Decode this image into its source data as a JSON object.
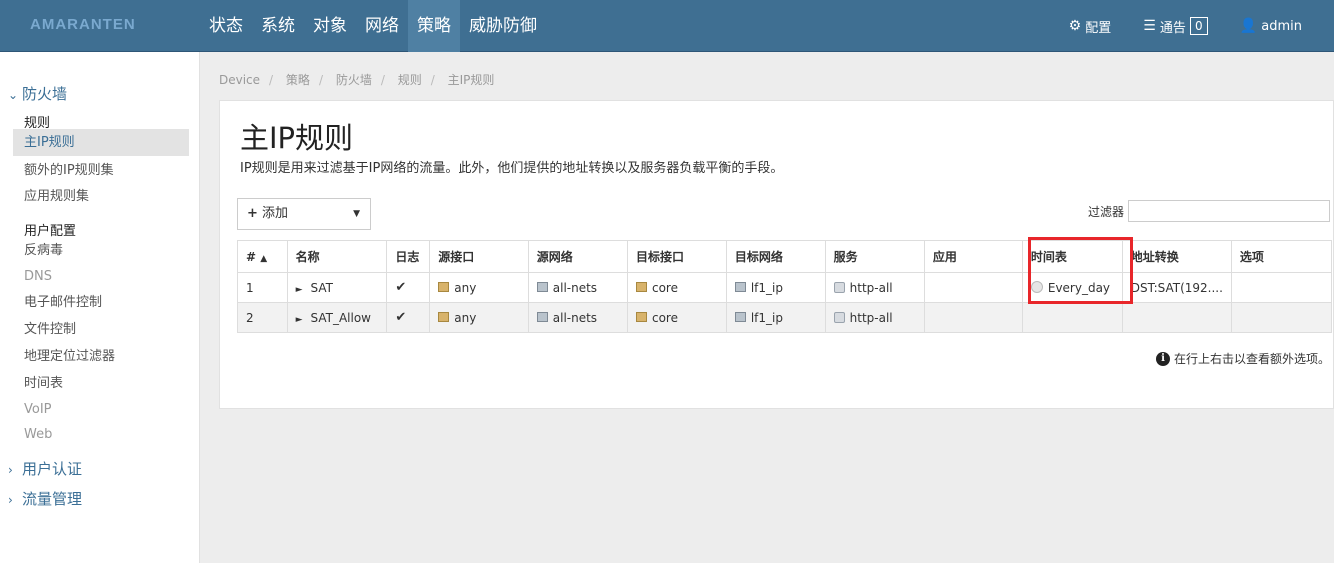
{
  "header": {
    "logo": "AMARANTEN",
    "nav": [
      "状态",
      "系统",
      "对象",
      "网络",
      "策略",
      "威胁防御"
    ],
    "active_nav": "策略",
    "config_label": "配置",
    "notice_label": "通告",
    "notice_count": "0",
    "user_label": "admin"
  },
  "sidebar": {
    "firewall_group": "防火墙",
    "rules_section": "规则",
    "rules_items": [
      "主IP规则",
      "额外的IP规则集",
      "应用规则集"
    ],
    "user_config_section": "用户配置",
    "user_config_items": [
      "反病毒",
      "DNS",
      "电子邮件控制",
      "文件控制",
      "地理定位过滤器",
      "时间表",
      "VoIP",
      "Web"
    ],
    "user_auth_group": "用户认证",
    "traffic_group": "流量管理"
  },
  "breadcrumb": [
    "Device",
    "策略",
    "防火墙",
    "规则",
    "主IP规则"
  ],
  "page": {
    "title": "主IP规则",
    "description": "IP规则是用来过滤基于IP网络的流量。此外，他们提供的地址转换以及服务器负载平衡的手段。",
    "add_label": "添加",
    "filter_label": "过滤器",
    "info_note": "在行上右击以查看额外选项。"
  },
  "table": {
    "columns": [
      "#",
      "名称",
      "日志",
      "源接口",
      "源网络",
      "目标接口",
      "目标网络",
      "服务",
      "应用",
      "时间表",
      "地址转换",
      "选项"
    ],
    "rows": [
      {
        "num": "1",
        "name": "SAT",
        "log": "✔",
        "src_if": "any",
        "src_net": "all-nets",
        "dst_if": "core",
        "dst_net": "lf1_ip",
        "service": "http-all",
        "app": "",
        "schedule": "Every_day",
        "nat": "DST:SAT(192....",
        "options": ""
      },
      {
        "num": "2",
        "name": "SAT_Allow",
        "log": "✔",
        "src_if": "any",
        "src_net": "all-nets",
        "dst_if": "core",
        "dst_net": "lf1_ip",
        "service": "http-all",
        "app": "",
        "schedule": "",
        "nat": "",
        "options": ""
      }
    ]
  }
}
